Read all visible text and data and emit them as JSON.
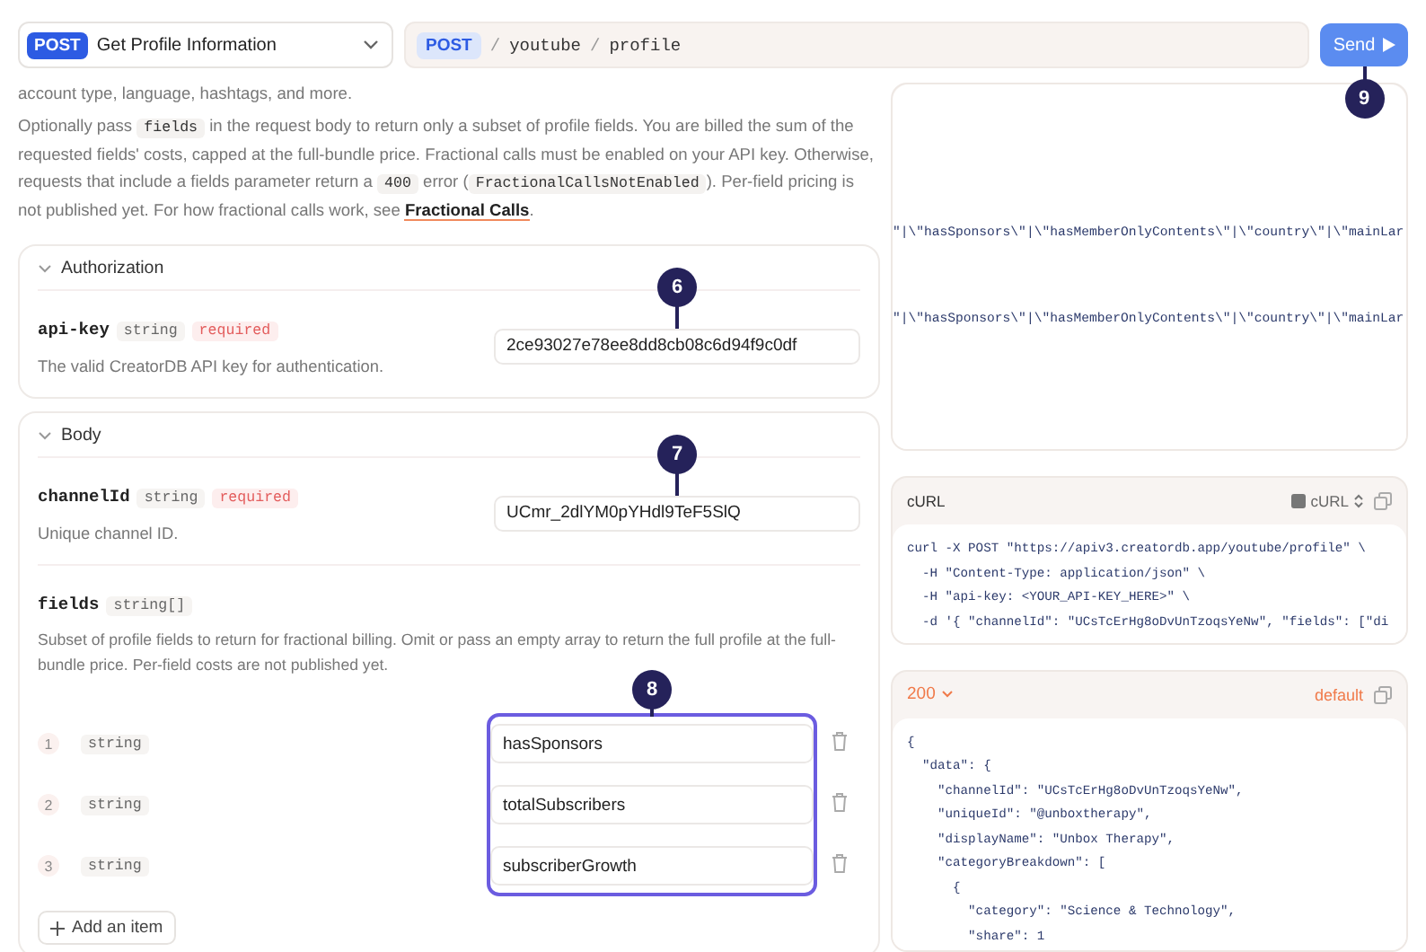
{
  "endpoint_select": {
    "method": "POST",
    "name": "Get Profile Information"
  },
  "url_bar": {
    "method": "POST",
    "path": [
      {
        "kind": "separator",
        "text": "/"
      },
      {
        "kind": "segment",
        "text": "youtube"
      },
      {
        "kind": "separator",
        "text": "/"
      },
      {
        "kind": "segment",
        "text": "profile"
      }
    ]
  },
  "send_button": {
    "label": "Send",
    "callout": "9"
  },
  "description": {
    "cut_line": "account type, language, hashtags, and more.",
    "paragraph": [
      {
        "kind": "text",
        "text": "Optionally pass "
      },
      {
        "kind": "code",
        "text": "fields"
      },
      {
        "kind": "text",
        "text": " in the request body to return only a subset of profile fields. You are billed the sum of the requested fields' costs, capped at the full-bundle price. Fractional calls must be enabled on your API key. Otherwise, requests that include a fields parameter return a "
      },
      {
        "kind": "code",
        "text": "400"
      },
      {
        "kind": "text",
        "text": " error ("
      },
      {
        "kind": "code",
        "text": "FractionalCallsNotEnabled"
      },
      {
        "kind": "text",
        "text": "). Per-field pricing is not published yet. For how fractional calls work, see "
      },
      {
        "kind": "link",
        "text": "Fractional Calls"
      },
      {
        "kind": "text",
        "text": "."
      }
    ]
  },
  "sections": [
    {
      "title": "Authorization",
      "expanded": true,
      "params": [
        {
          "kind": "scalar",
          "name": "api-key",
          "type": "string",
          "required": true,
          "required_label": "required",
          "description": "The valid CreatorDB API key for authentication.",
          "value": "2ce93027e78ee8dd8cb08c6d94f9c0df",
          "callout": "6"
        }
      ]
    },
    {
      "title": "Body",
      "expanded": true,
      "params": [
        {
          "kind": "scalar",
          "name": "channelId",
          "type": "string",
          "required": true,
          "required_label": "required",
          "description": "Unique channel ID.",
          "value": "UCmr_2dlYM0pYHdl9TeF5SlQ",
          "callout": "7"
        },
        {
          "kind": "array",
          "name": "fields",
          "type": "string[]",
          "required": false,
          "description": "Subset of profile fields to return for fractional billing. Omit or pass an empty array to return the full profile at the full-bundle price. Per-field costs are not published yet.",
          "callout": "8",
          "add_label": "Add an item",
          "items": [
            {
              "index": "1",
              "type": "string",
              "value": "hasSponsors"
            },
            {
              "index": "2",
              "type": "string",
              "value": "totalSubscribers"
            },
            {
              "index": "3",
              "type": "string",
              "value": "subscriberGrowth"
            }
          ]
        }
      ]
    }
  ],
  "preview_panel": {
    "lines": [
      "\"|\\\"hasSponsors\\\"|\\\"hasMemberOnlyContents\\\"|\\\"country\\\"|\\\"mainLar",
      "\"|\\\"hasSponsors\\\"|\\\"hasMemberOnlyContents\\\"|\\\"country\\\"|\\\"mainLar"
    ]
  },
  "curl_panel": {
    "title": "cURL",
    "language": "cURL",
    "lines": [
      "curl -X POST \"https://apiv3.creatordb.app/youtube/profile\" \\",
      "  -H \"Content-Type: application/json\" \\",
      "  -H \"api-key: <YOUR_API-KEY_HERE>\" \\",
      "  -d '{ \"channelId\": \"UCsTcErHg8oDvUnTzoqsYeNw\", \"fields\": [\"di"
    ]
  },
  "response_panel": {
    "status": "200",
    "label": "default",
    "lines": [
      "{",
      "  \"data\": {",
      "    \"channelId\": \"UCsTcErHg8oDvUnTzoqsYeNw\",",
      "    \"uniqueId\": \"@unboxtherapy\",",
      "    \"displayName\": \"Unbox Therapy\",",
      "    \"categoryBreakdown\": [",
      "      {",
      "        \"category\": \"Science & Technology\",",
      "        \"share\": 1"
    ]
  }
}
